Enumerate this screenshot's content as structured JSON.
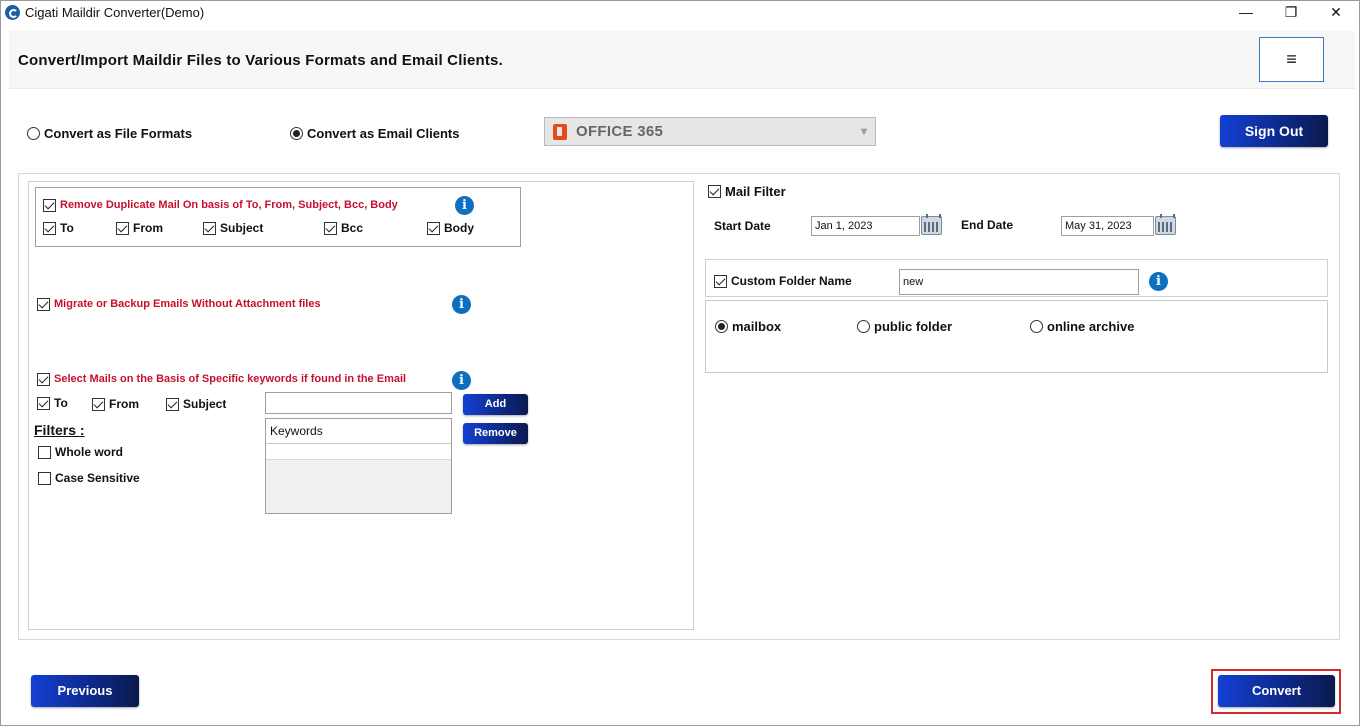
{
  "window": {
    "title": "Cigati Maildir Converter(Demo)",
    "controls": {
      "minimize": "—",
      "restore": "❐",
      "close": "✕"
    }
  },
  "header": {
    "title": "Convert/Import Maildir Files to Various Formats and Email Clients.",
    "menu_icon": "≡"
  },
  "mode": {
    "option_file_formats": "Convert as File Formats",
    "option_email_clients": "Convert as Email Clients",
    "selected": "email_clients"
  },
  "dropdown": {
    "value": "OFFICE 365",
    "icon": "office365-icon"
  },
  "sign_out": {
    "label": "Sign Out"
  },
  "left": {
    "dup": {
      "checked": true,
      "label": "Remove Duplicate Mail On basis of To, From, Subject, Bcc, Body",
      "fields": [
        {
          "label": "To",
          "checked": true
        },
        {
          "label": "From",
          "checked": true
        },
        {
          "label": "Subject",
          "checked": true
        },
        {
          "label": "Bcc",
          "checked": true
        },
        {
          "label": "Body",
          "checked": true
        }
      ]
    },
    "no_attach": {
      "checked": true,
      "label": "Migrate or Backup Emails Without Attachment files"
    },
    "keywords": {
      "checked": true,
      "label": "Select Mails on the Basis of Specific keywords if found in the Email",
      "fields": [
        {
          "label": "To",
          "checked": true
        },
        {
          "label": "From",
          "checked": true
        },
        {
          "label": "Subject",
          "checked": true
        }
      ],
      "input_value": "",
      "add_label": "Add",
      "remove_label": "Remove",
      "list_header": "Keywords"
    },
    "filters": {
      "title": "Filters :",
      "whole_word": {
        "label": "Whole word",
        "checked": false
      },
      "case_sensitive": {
        "label": "Case Sensitive",
        "checked": false
      }
    }
  },
  "right": {
    "mail_filter": {
      "checked": true,
      "label": "Mail Filter",
      "start_label": "Start Date",
      "start_value": "Jan 1, 2023",
      "end_label": "End Date",
      "end_value": "May 31, 2023"
    },
    "custom_folder": {
      "checked": true,
      "label": "Custom Folder Name",
      "value": "new"
    },
    "destination": {
      "options": [
        "mailbox",
        "public folder",
        "online archive"
      ],
      "selected": "mailbox"
    }
  },
  "footer": {
    "previous_label": "Previous",
    "convert_label": "Convert"
  },
  "colors": {
    "button_start": "#1440d4",
    "button_end": "#0b1a4d",
    "red_label": "#c8102e",
    "info": "#0d6fbf",
    "highlight_frame": "#d32a2a"
  }
}
